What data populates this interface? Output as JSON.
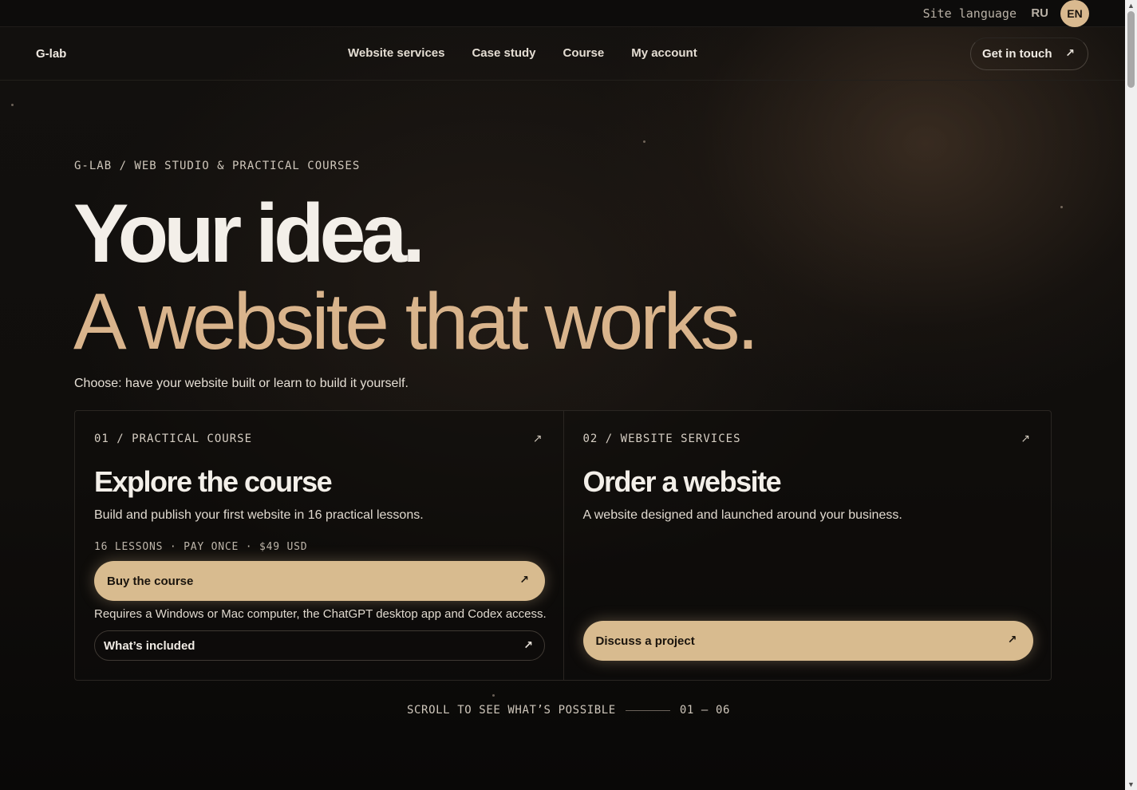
{
  "topbar": {
    "language_label": "Site language",
    "languages": [
      "RU",
      "EN"
    ],
    "active_language": "EN"
  },
  "nav": {
    "logo": "G-lab",
    "links": [
      "Website services",
      "Case study",
      "Course",
      "My account"
    ],
    "cta_label": "Get in touch",
    "cta_icon": "arrow-up-right-icon"
  },
  "hero": {
    "eyebrow": "G-LAB / WEB STUDIO & PRACTICAL COURSES",
    "headline_line1": "Your idea.",
    "headline_line2": "A website that works.",
    "lead": "Choose: have your website built or learn to build it yourself."
  },
  "cards": [
    {
      "eyebrow": "01 / PRACTICAL COURSE",
      "title": "Explore the course",
      "description": "Build and publish your first website in 16 practical lessons.",
      "meta": "16 LESSONS · PAY ONCE · $49 USD",
      "primary_button": "Buy the course",
      "note": "Requires a Windows or Mac computer, the ChatGPT desktop app and Codex access.",
      "secondary_button": "What’s included"
    },
    {
      "eyebrow": "02 / WEBSITE SERVICES",
      "title": "Order a website",
      "description": "A website designed and launched around your business.",
      "primary_button": "Discuss a project"
    }
  ],
  "scroll_hint": {
    "label": "SCROLL TO SEE WHAT’S POSSIBLE",
    "range": "01 — 06"
  },
  "colors": {
    "background": "#0b0a09",
    "accent": "#d8bb8f",
    "headline_accent": "#d9b48c",
    "text": "#ece7df"
  }
}
